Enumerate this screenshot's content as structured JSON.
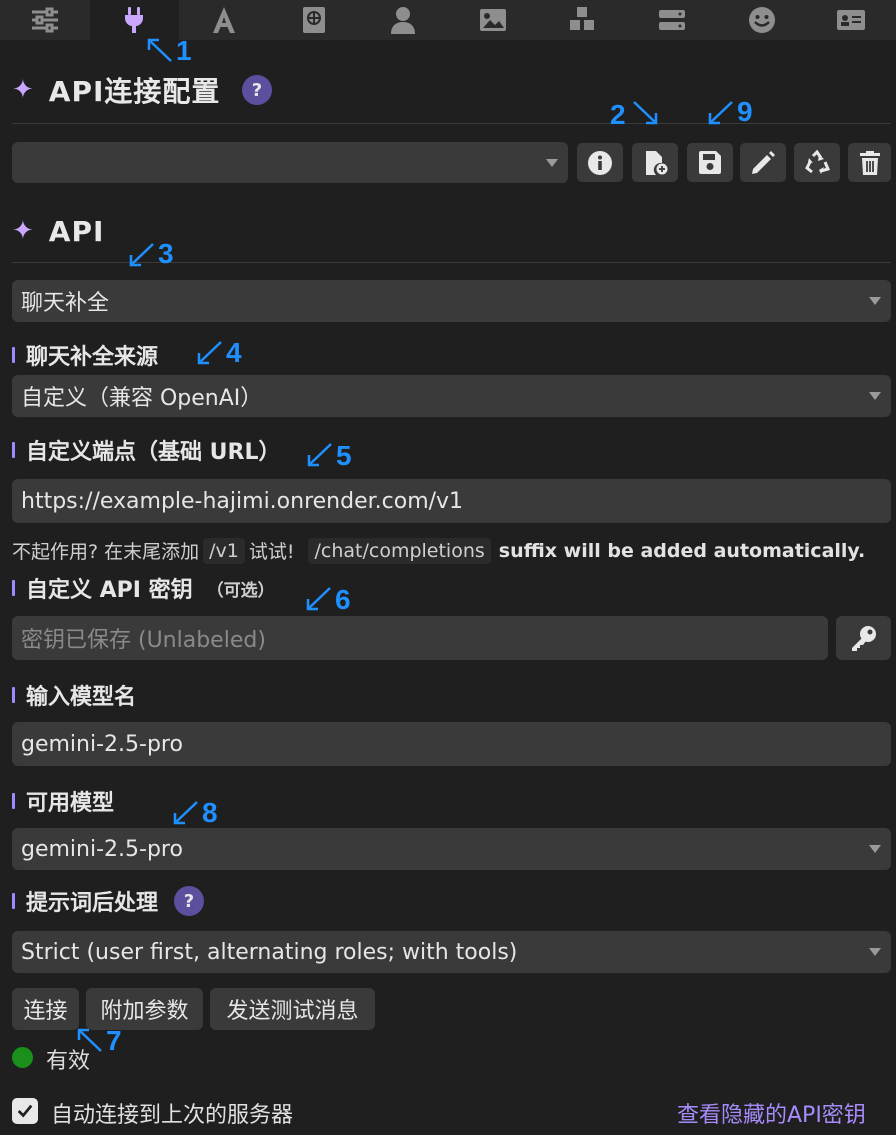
{
  "tabs": [
    {
      "icon": "sliders-icon"
    },
    {
      "icon": "plug-icon"
    },
    {
      "icon": "font-icon"
    },
    {
      "icon": "book-globe-icon"
    },
    {
      "icon": "user-icon"
    },
    {
      "icon": "image-icon"
    },
    {
      "icon": "cubes-icon"
    },
    {
      "icon": "server-icon"
    },
    {
      "icon": "smile-icon"
    },
    {
      "icon": "id-card-icon"
    }
  ],
  "api_connection": {
    "title": "API连接配置",
    "help": "?",
    "preset_value": ""
  },
  "api": {
    "title": "API",
    "type_value": "聊天补全"
  },
  "chat_source": {
    "label": "聊天补全来源",
    "value": "自定义（兼容 OpenAI）"
  },
  "endpoint": {
    "label": "自定义端点（基础 URL）",
    "value": "https://example-hajimi.onrender.com/v1"
  },
  "note": {
    "prefix": "不起作用? 在末尾添加",
    "code1": "/v1",
    "mid": "试试!",
    "code2": "/chat/completions",
    "suffix": "suffix will be added automatically."
  },
  "api_key": {
    "label": "自定义 API 密钥",
    "optional": "（可选）",
    "placeholder": "密钥已保存 (Unlabeled)"
  },
  "model_input": {
    "label": "输入模型名",
    "value": "gemini-2.5-pro"
  },
  "available_models": {
    "label": "可用模型",
    "value": "gemini-2.5-pro"
  },
  "prompt_post": {
    "label": "提示词后处理",
    "help": "?",
    "value": "Strict (user first, alternating roles; with tools)"
  },
  "buttons": {
    "connect": "连接",
    "extra_params": "附加参数",
    "send_test": "发送测试消息"
  },
  "status": {
    "text": "有效",
    "color": "#1a8f1a"
  },
  "auto_connect": {
    "label": "自动连接到上次的服务器",
    "checked": true
  },
  "hidden_keys_link": "查看隐藏的API密钥",
  "annotations": [
    "1",
    "2",
    "9",
    "3",
    "4",
    "5",
    "6",
    "8",
    "7"
  ],
  "colors": {
    "accent": "#9d8cff",
    "annotation": "#1e90ff",
    "link": "#a78bfa"
  }
}
